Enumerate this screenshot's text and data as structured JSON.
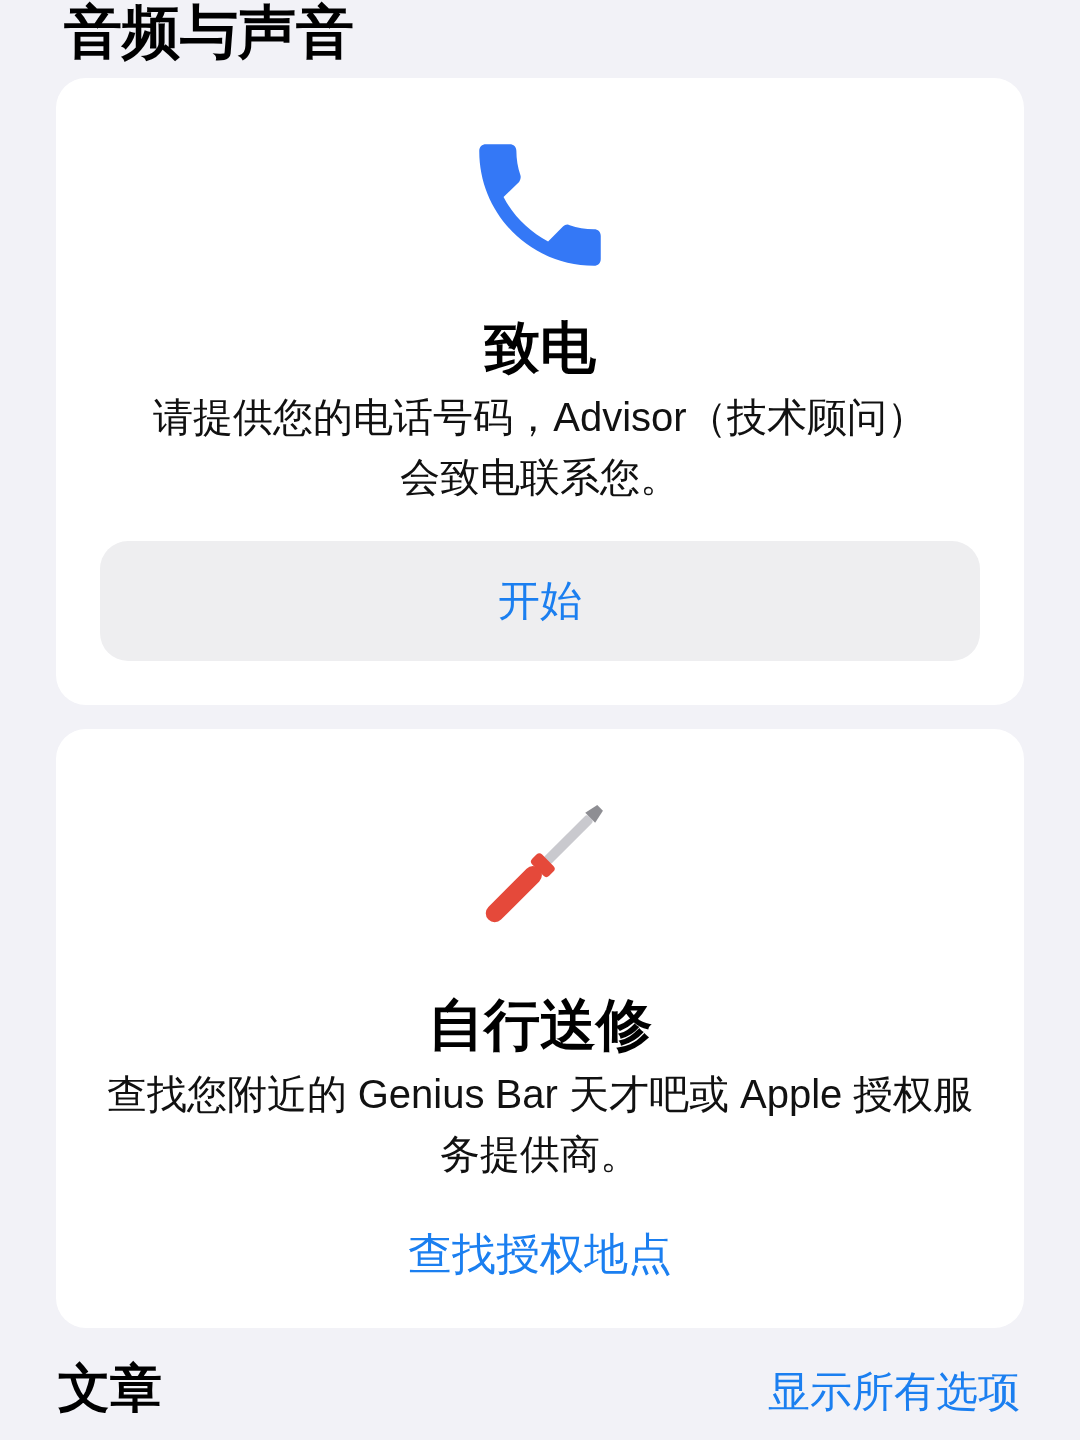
{
  "section_title": "音频与声音",
  "cards": [
    {
      "kind": "phone",
      "title": "致电",
      "description": "请提供您的电话号码，Advisor（技术顾问）会致电联系您。",
      "action": {
        "kind": "button",
        "label": "开始"
      }
    },
    {
      "kind": "screwdriver",
      "title": "自行送修",
      "description": "查找您附近的 Genius Bar 天才吧或 Apple 授权服务提供商。",
      "action": {
        "kind": "link",
        "label": "查找授权地点"
      }
    }
  ],
  "footer": {
    "title": "文章",
    "link": "显示所有选项"
  }
}
